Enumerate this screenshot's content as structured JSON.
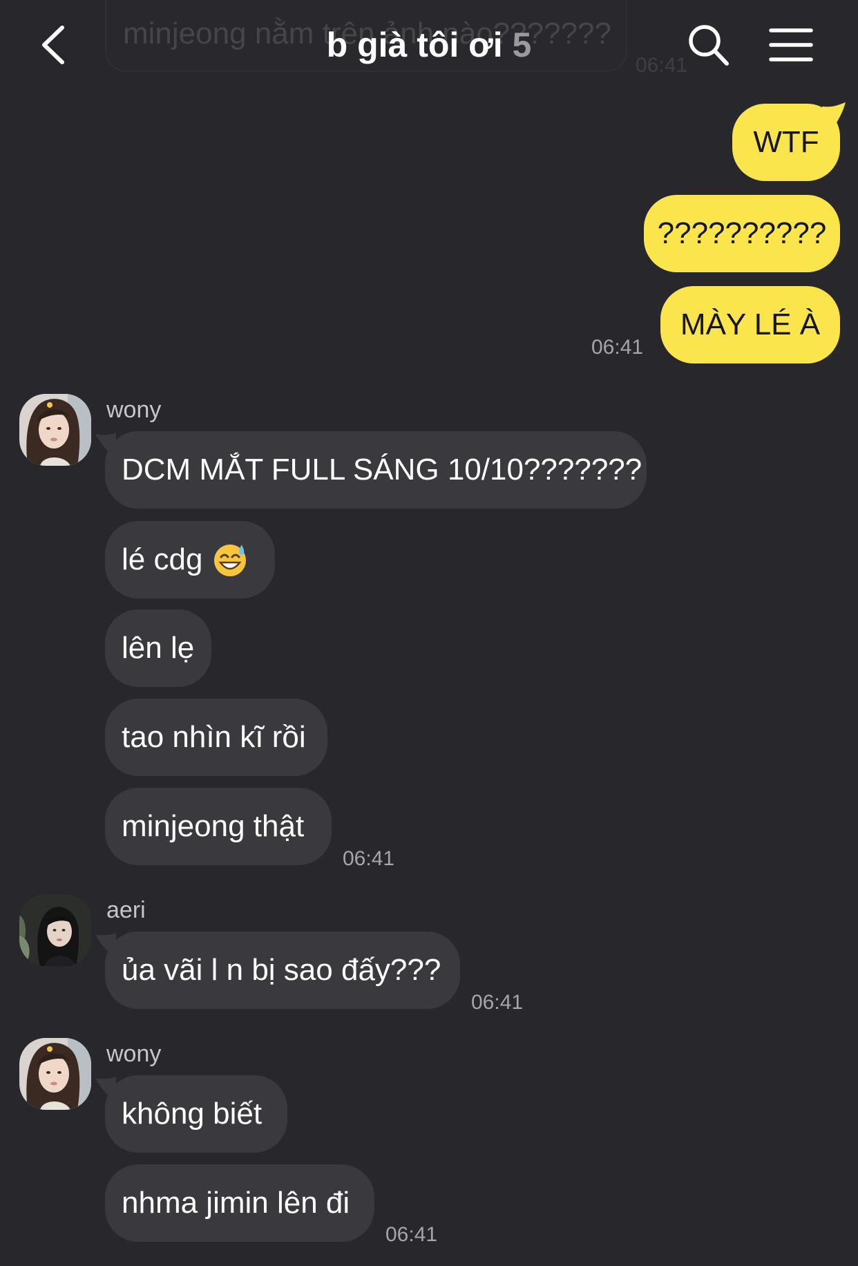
{
  "header": {
    "title": "b già tôi ơi",
    "member_count": "5",
    "ghost_message": "minjeong nằm trên ảnh nào???????",
    "ghost_time": "06:41"
  },
  "messages": {
    "me": {
      "m1": "WTF",
      "m2": "??????????",
      "m3": "MÀY LÉ À",
      "time": "06:41"
    },
    "wony1": {
      "sender": "wony",
      "m1": "DCM MẮT FULL SÁNG 10/10???????",
      "m2": "lé cdg",
      "m2_emoji": "grinning-sweat-emoji",
      "m3": "lên lẹ",
      "m4": "tao nhìn kĩ rồi",
      "m5": "minjeong thật",
      "time": "06:41"
    },
    "aeri": {
      "sender": "aeri",
      "m1": "ủa vãi l n bị sao đấy???",
      "time": "06:41"
    },
    "wony2": {
      "sender": "wony",
      "m1": "không biết",
      "m2": "nhma jimin lên đi",
      "time": "06:41"
    }
  },
  "colors": {
    "background": "#28282c",
    "my_bubble": "#fbe54d",
    "their_bubble": "#3a3a3e",
    "timestamp": "#a6a6aa"
  },
  "icons": {
    "back": "chevron-left-icon",
    "search": "search-icon",
    "menu": "hamburger-menu-icon"
  }
}
